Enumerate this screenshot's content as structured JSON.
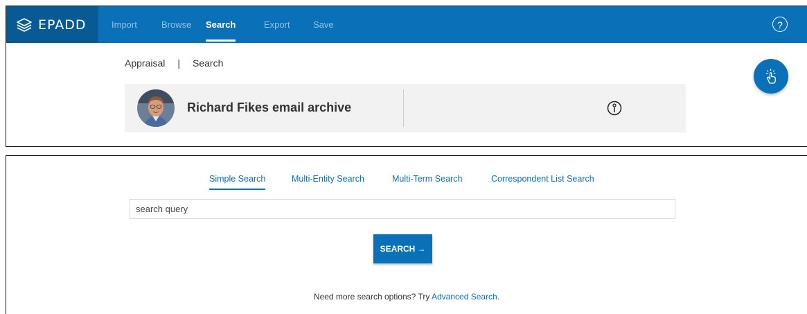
{
  "app": {
    "brand": "ePADD"
  },
  "nav": {
    "items": [
      {
        "label": "Import",
        "active": false
      },
      {
        "label": "Browse",
        "active": false
      },
      {
        "label": "Search",
        "active": true
      },
      {
        "label": "Export",
        "active": false
      },
      {
        "label": "Save",
        "active": false
      }
    ],
    "help_icon": "question-circle-icon"
  },
  "breadcrumb": {
    "items": [
      "Appraisal",
      "Search"
    ],
    "separator": "|"
  },
  "archive": {
    "title": "Richard Fikes email archive",
    "info_icon": "info-circle-icon"
  },
  "fab": {
    "icon": "tap-gesture-icon"
  },
  "tabs": [
    {
      "label": "Simple Search",
      "active": true
    },
    {
      "label": "Multi-Entity Search",
      "active": false
    },
    {
      "label": "Multi-Term Search",
      "active": false
    },
    {
      "label": "Correspondent List Search",
      "active": false
    }
  ],
  "search": {
    "placeholder": "search query",
    "value": "",
    "button_label": "SEARCH",
    "button_arrow": "→"
  },
  "more_options": {
    "prefix": "Need more search options? Try ",
    "link": "Advanced Search",
    "suffix": "."
  },
  "colors": {
    "brand_blue": "#0a70b8",
    "brand_dark": "#075a94",
    "card_bg": "#f2f2f2"
  }
}
